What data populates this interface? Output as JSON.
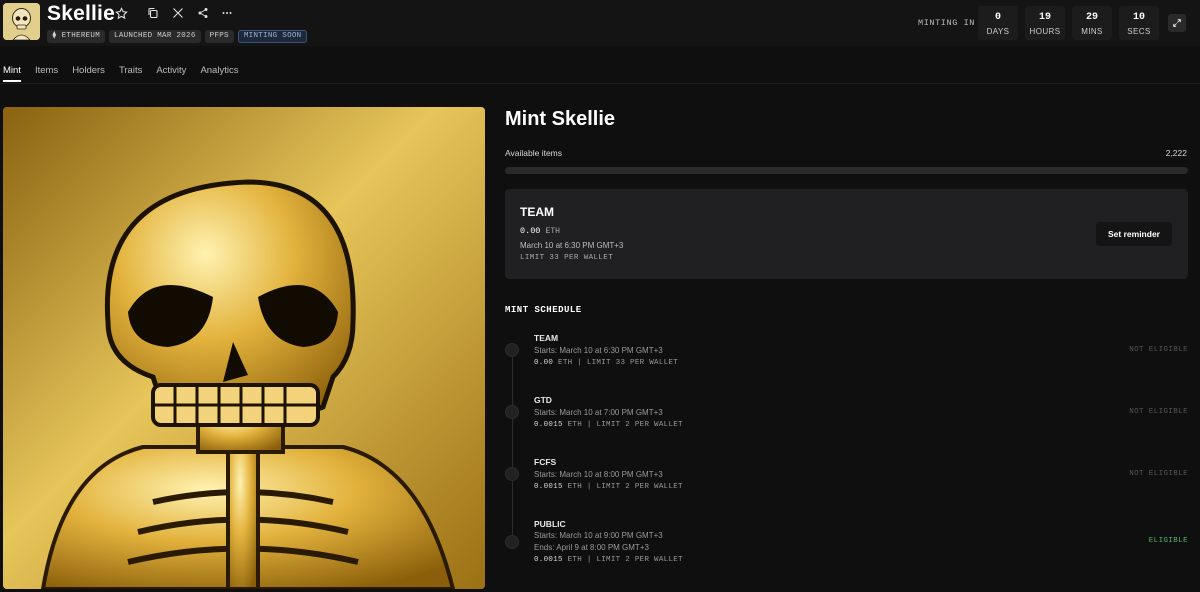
{
  "header": {
    "title": "Skellie",
    "tags": [
      "ETHEREUM",
      "LAUNCHED MAR 2026",
      "PFPS",
      "MINTING SOON"
    ],
    "minting_in_label": "MINTING IN",
    "countdown": [
      {
        "value": "0",
        "label": "DAYS"
      },
      {
        "value": "19",
        "label": "HOURS"
      },
      {
        "value": "29",
        "label": "MINS"
      },
      {
        "value": "10",
        "label": "SECS"
      }
    ]
  },
  "tabs": [
    "Mint",
    "Items",
    "Holders",
    "Traits",
    "Activity",
    "Analytics"
  ],
  "mint": {
    "title": "Mint Skellie",
    "available_label": "Available items",
    "available_value": "2,222",
    "progress_fraction": 0
  },
  "team_card": {
    "name": "TEAM",
    "price": "0.00",
    "unit": "ETH",
    "date": "March 10 at 6:30 PM GMT+3",
    "limit": "LIMIT 33 PER WALLET",
    "reminder_label": "Set reminder"
  },
  "schedule": {
    "title": "MINT SCHEDULE",
    "phases": [
      {
        "name": "TEAM",
        "starts": "Starts: March 10 at 6:30 PM GMT+3",
        "ends": "",
        "price": "0.00",
        "unit": "ETH",
        "limit": "| LIMIT 33 PER WALLET",
        "status": "NOT ELIGIBLE"
      },
      {
        "name": "GTD",
        "starts": "Starts: March 10 at 7:00 PM GMT+3",
        "ends": "",
        "price": "0.0015",
        "unit": "ETH",
        "limit": "| LIMIT 2 PER WALLET",
        "status": "NOT ELIGIBLE"
      },
      {
        "name": "FCFS",
        "starts": "Starts: March 10 at 8:00 PM GMT+3",
        "ends": "",
        "price": "0.0015",
        "unit": "ETH",
        "limit": "| LIMIT 2 PER WALLET",
        "status": "NOT ELIGIBLE"
      },
      {
        "name": "PUBLIC",
        "starts": "Starts: March 10 at 9:00 PM GMT+3",
        "ends": "Ends: April 9 at 8:00 PM GMT+3",
        "price": "0.0015",
        "unit": "ETH",
        "limit": "| LIMIT 2 PER WALLET",
        "status": "ELIGIBLE"
      }
    ]
  },
  "colors": {
    "background": "#0f0f10",
    "eligible": "#4fb86a",
    "not_eligible": "#555555",
    "art_gold": "#d9a82a"
  }
}
